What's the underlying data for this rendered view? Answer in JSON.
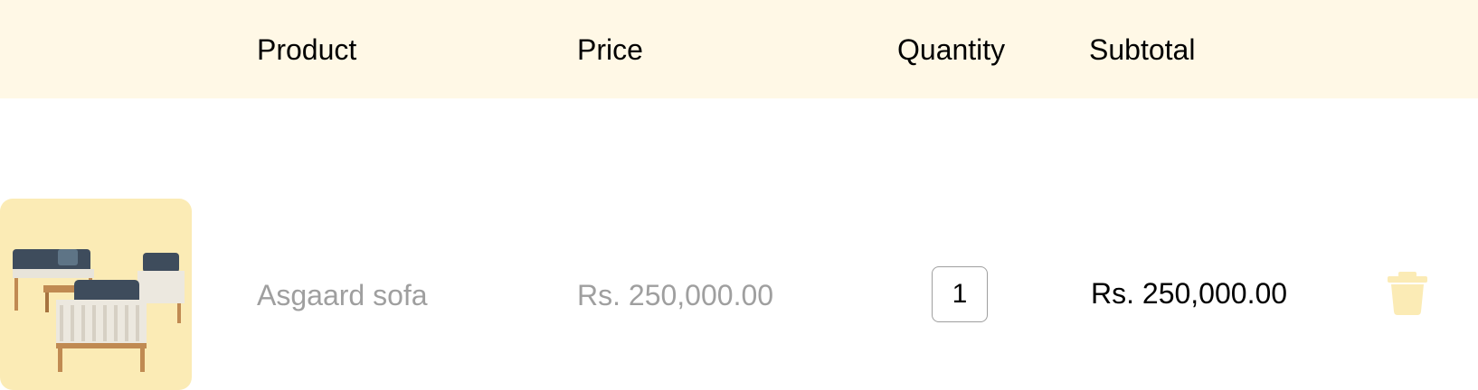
{
  "table_header": {
    "product": "Product",
    "price": "Price",
    "quantity": "Quantity",
    "subtotal": "Subtotal"
  },
  "cart_items": [
    {
      "name": "Asgaard sofa",
      "price": "Rs. 250,000.00",
      "quantity": "1",
      "subtotal": "Rs. 250,000.00",
      "image_icon": "sofa-set-image"
    }
  ],
  "colors": {
    "header_bg": "#FFF8E6",
    "thumb_bg": "#FBEBB5",
    "muted_text": "#9F9F9F",
    "trash_icon": "#FBEBB5"
  }
}
